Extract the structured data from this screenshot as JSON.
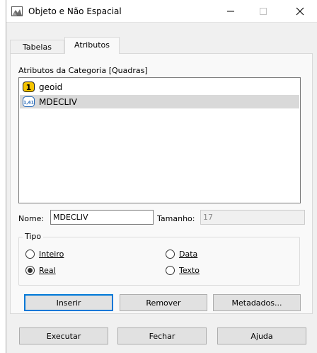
{
  "window": {
    "title": "Objeto e Não Espacial",
    "minimize_glyph": "—",
    "close_glyph": "✕"
  },
  "tabs": [
    {
      "label": "Tabelas",
      "active": false
    },
    {
      "label": "Atributos",
      "active": true
    }
  ],
  "attributes_panel": {
    "section_label": "Atributos da Categoria [Quadras]",
    "items": [
      {
        "label": "geoid",
        "icon": "integer-type-icon",
        "icon_text": "1",
        "selected": false
      },
      {
        "label": "MDECLIV",
        "icon": "real-type-icon",
        "icon_text": "1,41",
        "selected": true
      }
    ]
  },
  "fields": {
    "name_label": "Nome:",
    "name_value": "MDECLIV",
    "size_label": "Tamanho:",
    "size_value": "17"
  },
  "type_group": {
    "title": "Tipo",
    "options": [
      {
        "label": "Inteiro",
        "checked": false
      },
      {
        "label": "Data",
        "checked": false
      },
      {
        "label": "Real",
        "checked": true
      },
      {
        "label": "Texto",
        "checked": false
      }
    ]
  },
  "action_buttons": {
    "insert": "Inserir",
    "remove": "Remover",
    "metadata": "Metadados..."
  },
  "footer_buttons": {
    "execute": "Executar",
    "close": "Fechar",
    "help": "Ajuda"
  },
  "colors": {
    "accent": "#0078d7",
    "selection": "#d9d9d9",
    "integer_icon": "#f5c400",
    "real_icon": "#1e63b5"
  }
}
